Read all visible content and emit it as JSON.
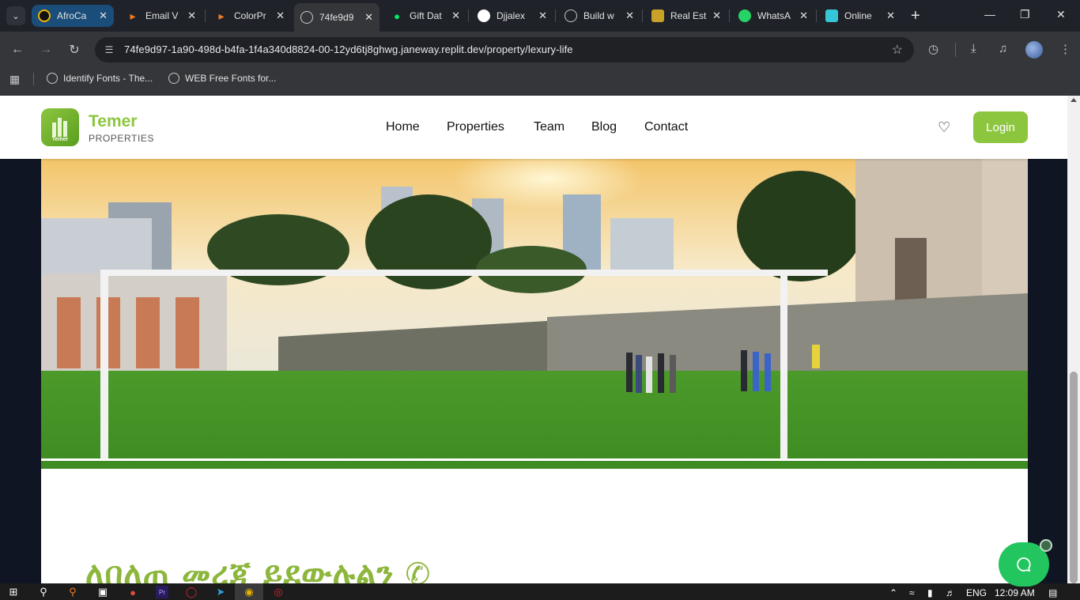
{
  "browser": {
    "tabs": [
      {
        "title": "AfroCa",
        "color": "#f2b400"
      },
      {
        "title": "Email V",
        "color": "#f47b20"
      },
      {
        "title": "ColorPr",
        "color": "#f47b20"
      },
      {
        "title": "74fe9d9",
        "color": "#8a8d93"
      },
      {
        "title": "Gift Dat",
        "color": "#00ed64"
      },
      {
        "title": "Djjalex",
        "color": "#ffffff"
      },
      {
        "title": "Build w",
        "color": "#c4c7c5"
      },
      {
        "title": "Real Est",
        "color": "#c9a227"
      },
      {
        "title": "WhatsA",
        "color": "#25d366"
      },
      {
        "title": "Online",
        "color": "#36c5d8"
      }
    ],
    "url": "74fe9d97-1a90-498d-b4fa-1f4a340d8824-00-12yd6tj8ghwg.janeway.replit.dev/property/lexury-life",
    "bookmarks": [
      {
        "label": "Identify Fonts - The..."
      },
      {
        "label": "WEB Free Fonts for..."
      }
    ]
  },
  "site": {
    "brand": {
      "name": "Temer",
      "sub": "PROPERTIES",
      "mark": "Temer",
      "color": "#8cc63f"
    },
    "nav": [
      "Home",
      "Properties",
      "Team",
      "Blog",
      "Contact"
    ],
    "login_label": "Login",
    "heading": "ለበለጠ መረጃ ይደውሉልን"
  },
  "taskbar": {
    "lang": "ENG",
    "time": "12:09 AM"
  }
}
